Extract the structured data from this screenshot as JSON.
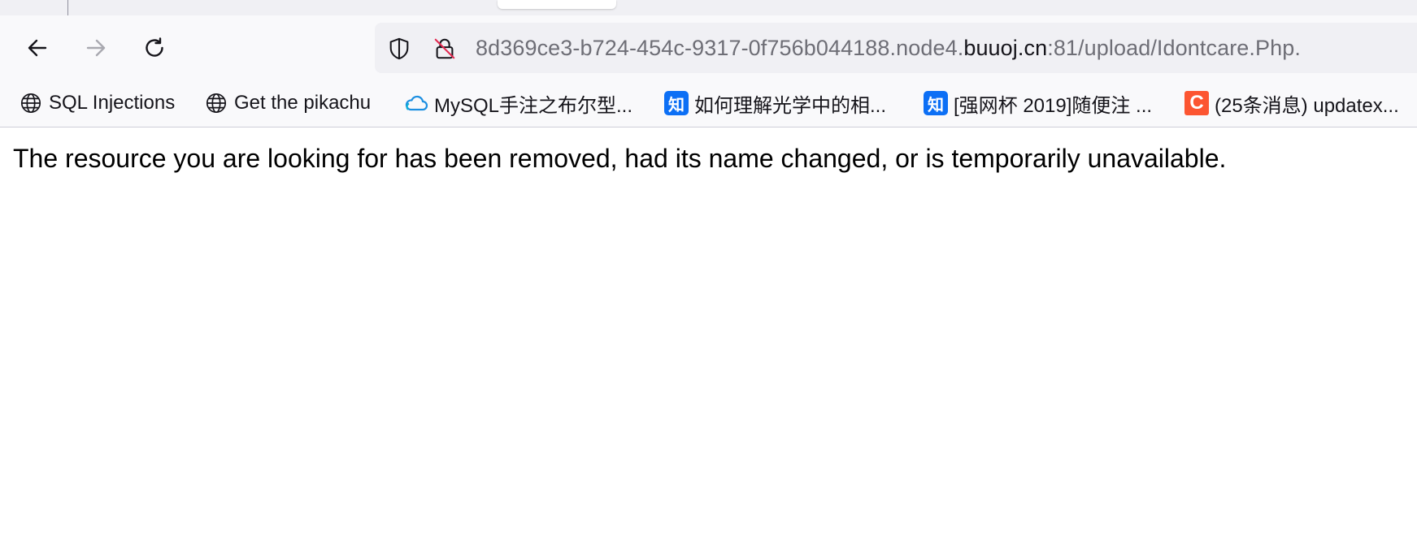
{
  "tabs": {
    "active_tab_label": ""
  },
  "toolbar": {
    "back_icon": "arrow-left-icon",
    "forward_icon": "arrow-right-icon",
    "reload_icon": "reload-icon"
  },
  "urlbar": {
    "prefix": "8d369ce3-b724-454c-9317-0f756b044188.node4.",
    "domain": "buuoj.cn",
    "suffix": ":81/upload/Idontcare.Php.",
    "shield_icon": "shield-icon",
    "insecure_icon": "insecure-lock-icon"
  },
  "bookmarks": [
    {
      "label": "SQL Injections",
      "icon": "globe-icon"
    },
    {
      "label": "Get the pikachu",
      "icon": "globe-icon"
    },
    {
      "label": "MySQL手注之布尔型...",
      "icon": "cloud-icon"
    },
    {
      "label": "如何理解光学中的相...",
      "icon": "zhihu-icon",
      "icon_text": "知"
    },
    {
      "label": "[强网杯 2019]随便注 ...",
      "icon": "zhihu-icon",
      "icon_text": "知"
    },
    {
      "label": "(25条消息) updatex...",
      "icon": "csdn-icon",
      "icon_text": "C"
    }
  ],
  "page": {
    "message": "The resource you are looking for has been removed, had its name changed, or is temporarily unavailable."
  },
  "colors": {
    "toolbar_bg": "#f9f9fb",
    "urlbar_bg": "#f0f0f4",
    "zhihu_blue": "#0c6ff5",
    "csdn_red": "#fc5531",
    "insecure_strike": "#e22850"
  }
}
